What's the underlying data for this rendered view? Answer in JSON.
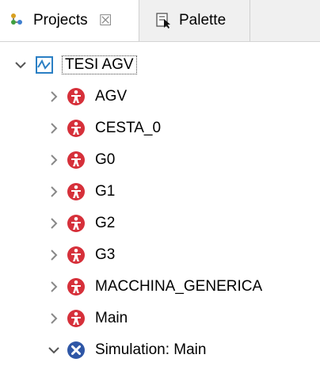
{
  "tabs": [
    {
      "label": "Projects",
      "close_glyph": "☒",
      "icon": "projects-icon"
    },
    {
      "label": "Palette",
      "icon": "palette-icon"
    }
  ],
  "tree": {
    "root": {
      "label": "TESI AGV",
      "expanded": true,
      "icon": "model-icon"
    },
    "agents": [
      {
        "label": "AGV"
      },
      {
        "label": "CESTA_0"
      },
      {
        "label": "G0"
      },
      {
        "label": "G1"
      },
      {
        "label": "G2"
      },
      {
        "label": "G3"
      },
      {
        "label": "MACCHINA_GENERICA"
      },
      {
        "label": "Main"
      }
    ],
    "simulation": {
      "label": "Simulation: Main",
      "expanded": true
    }
  },
  "colors": {
    "agent_icon": "#d6303a",
    "simulation_icon": "#2e56a6",
    "model_icon": "#2a7fc4",
    "twisty": "#777777"
  }
}
